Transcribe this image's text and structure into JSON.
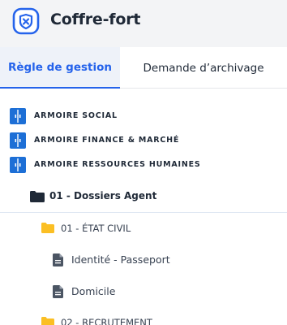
{
  "app": {
    "title": "Coffre-fort",
    "logo_icon": "vault-shield-icon",
    "accent": "#2563eb"
  },
  "tabs": [
    {
      "label": "Règle de gestion",
      "active": true
    },
    {
      "label": "Demande d’archivage",
      "active": false
    }
  ],
  "tree": {
    "cabinets": [
      {
        "label": "ARMOIRE SOCIAL",
        "icon": "cabinet-icon"
      },
      {
        "label": "ARMOIRE FINANCE & MARCHÉ",
        "icon": "cabinet-icon"
      },
      {
        "label": "ARMOIRE RESSOURCES HUMAINES",
        "icon": "cabinet-icon"
      }
    ],
    "selected_folder": {
      "label": "01 - Dossiers Agent",
      "icon": "folder-icon"
    },
    "subfolders": [
      {
        "label": "01 - ÉTAT CIVIL",
        "icon": "folder-icon",
        "documents": [
          {
            "label": "Identité - Passeport",
            "icon": "document-icon"
          },
          {
            "label": "Domicile",
            "icon": "document-icon"
          }
        ]
      },
      {
        "label": "02 - RECRUTEMENT",
        "icon": "folder-icon"
      }
    ]
  }
}
